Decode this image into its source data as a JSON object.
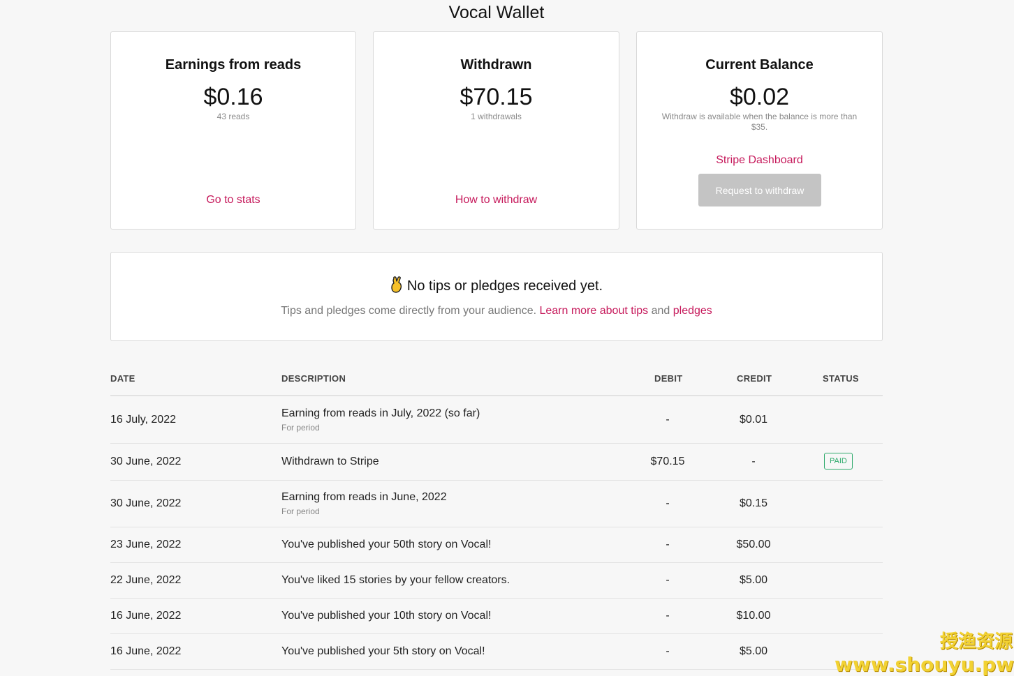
{
  "header": {
    "title": "Vocal Wallet"
  },
  "cards": {
    "earnings": {
      "title": "Earnings from reads",
      "amount": "$0.16",
      "sub": "43 reads",
      "link": "Go to stats"
    },
    "withdrawn": {
      "title": "Withdrawn",
      "amount": "$70.15",
      "sub": "1 withdrawals",
      "link": "How to withdraw"
    },
    "balance": {
      "title": "Current Balance",
      "amount": "$0.02",
      "sub": "Withdraw is available when the balance is more than $35.",
      "link": "Stripe Dashboard",
      "button": "Request to withdraw"
    }
  },
  "tips": {
    "heading": "No tips or pledges received yet.",
    "text": "Tips and pledges come directly from your audience. ",
    "link1": "Learn more about tips",
    "and": " and ",
    "link2": "pledges",
    "icon": "crossed-fingers-icon"
  },
  "ledger": {
    "headers": {
      "date": "DATE",
      "description": "DESCRIPTION",
      "debit": "DEBIT",
      "credit": "CREDIT",
      "status": "STATUS"
    },
    "rows": [
      {
        "date": "16 July, 2022",
        "description": "Earning from reads in July, 2022 (so far)",
        "sub": "For period",
        "debit": "-",
        "credit": "$0.01",
        "status": ""
      },
      {
        "date": "30 June, 2022",
        "description": "Withdrawn to Stripe",
        "sub": "",
        "debit": "$70.15",
        "credit": "-",
        "status": "PAID"
      },
      {
        "date": "30 June, 2022",
        "description": "Earning from reads in June, 2022",
        "sub": "For period",
        "debit": "-",
        "credit": "$0.15",
        "status": ""
      },
      {
        "date": "23 June, 2022",
        "description": "You've published your 50th story on Vocal!",
        "sub": "",
        "debit": "-",
        "credit": "$50.00",
        "status": ""
      },
      {
        "date": "22 June, 2022",
        "description": "You've liked 15 stories by your fellow creators.",
        "sub": "",
        "debit": "-",
        "credit": "$5.00",
        "status": ""
      },
      {
        "date": "16 June, 2022",
        "description": "You've published your 10th story on Vocal!",
        "sub": "",
        "debit": "-",
        "credit": "$10.00",
        "status": ""
      },
      {
        "date": "16 June, 2022",
        "description": "You've published your 5th story on Vocal!",
        "sub": "",
        "debit": "-",
        "credit": "$5.00",
        "status": ""
      }
    ]
  },
  "watermark": {
    "line1": "授渔资源",
    "line2": "www.shouyu.pw"
  },
  "colors": {
    "accent": "#c6195b",
    "paid": "#2eaa6b",
    "disabled_button": "#c4c4c4"
  }
}
